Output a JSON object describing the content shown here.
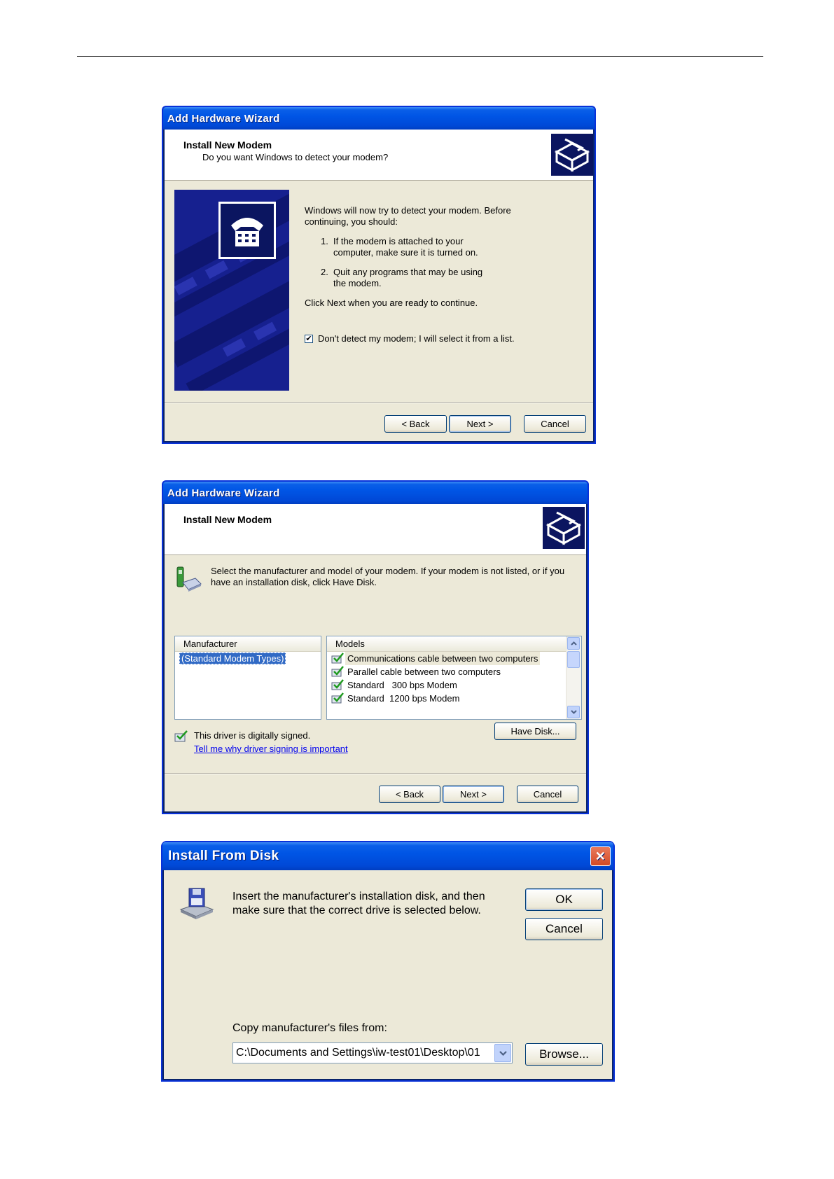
{
  "wizard1": {
    "title": "Add Hardware Wizard",
    "header_title": "Install New Modem",
    "header_subtitle": "Do you want Windows to detect your modem?",
    "intro_line1": "Windows will now try to detect your modem.  Before",
    "intro_line2": "continuing, you should:",
    "step1_num": "1.",
    "step1_line1": "If the modem is attached to your",
    "step1_line2": "computer, make sure it is turned on.",
    "step2_num": "2.",
    "step2_line1": "Quit any programs that may be using",
    "step2_line2": "the modem.",
    "continue_text": "Click Next when you are ready to continue.",
    "checkbox_label": "Don't detect my modem; I will select it from a list.",
    "checkbox_checked": true,
    "checkbox_mark": "✔",
    "back_label": "< Back",
    "next_label": "Next >",
    "cancel_label": "Cancel"
  },
  "wizard2": {
    "title": "Add Hardware Wizard",
    "header_title": "Install New Modem",
    "instruction_line1": "Select the manufacturer and model of your modem. If your modem is not listed, or if you",
    "instruction_line2": "have an installation disk, click Have Disk.",
    "manufacturer_header": "Manufacturer",
    "manufacturers": [
      "(Standard Modem Types)"
    ],
    "models_header": "Models",
    "models": [
      "Communications cable between two computers",
      "Parallel cable between two computers",
      "Standard   300 bps Modem",
      "Standard  1200 bps Modem"
    ],
    "signed_text": "This driver is digitally signed.",
    "signing_link": "Tell me why driver signing is important",
    "have_disk_label": "Have Disk...",
    "back_label": "< Back",
    "next_label": "Next >",
    "cancel_label": "Cancel"
  },
  "install_disk": {
    "title": "Install From Disk",
    "close_glyph": "✕",
    "message_line1": "Insert the manufacturer's installation disk, and then",
    "message_line2": "make sure that the correct drive is selected below.",
    "ok_label": "OK",
    "cancel_label": "Cancel",
    "copy_label": "Copy manufacturer's files from:",
    "path_value": "C:\\Documents and Settings\\iw-test01\\Desktop\\01",
    "browse_label": "Browse..."
  },
  "colors": {
    "title_blue": "#0055e5",
    "dialog_face": "#ece9d8",
    "selection": "#316ac5",
    "link": "#0000ee",
    "close_red": "#e04a2a"
  },
  "icons": [
    "hardware-wizard-icon",
    "telephone-icon",
    "modem-phone-icon",
    "model-driver-icon",
    "signed-driver-icon",
    "floppy-install-icon",
    "dropdown-arrow-icon",
    "scroll-up-icon",
    "scroll-down-icon",
    "close-icon"
  ]
}
